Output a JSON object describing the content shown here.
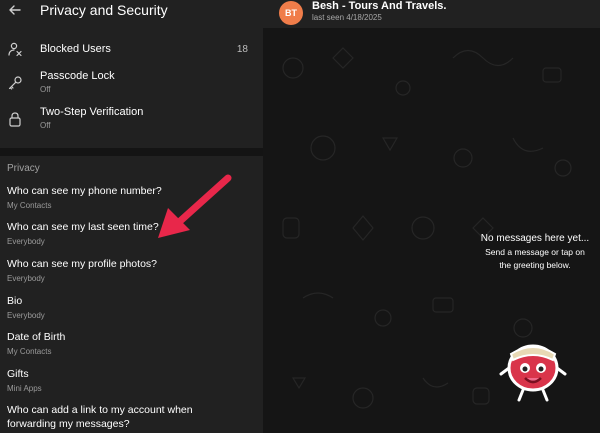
{
  "left_panel": {
    "header": {
      "title": "Privacy and Security"
    },
    "security_items": [
      {
        "title": "Blocked Users",
        "count": "18",
        "icon": "person-blocked-icon"
      },
      {
        "title": "Passcode Lock",
        "subtitle": "Off",
        "icon": "key-icon"
      },
      {
        "title": "Two-Step Verification",
        "subtitle": "Off",
        "icon": "lock-icon"
      }
    ],
    "privacy": {
      "section_title": "Privacy",
      "items": [
        {
          "title": "Who can see my phone number?",
          "value": "My Contacts"
        },
        {
          "title": "Who can see my last seen time?",
          "value": "Everybody"
        },
        {
          "title": "Who can see my profile photos?",
          "value": "Everybody"
        },
        {
          "title": "Bio",
          "value": "Everybody"
        },
        {
          "title": "Date of Birth",
          "value": "My Contacts"
        },
        {
          "title": "Gifts",
          "value": "Mini Apps"
        },
        {
          "title_line1": "Who can add a link to my account when",
          "title_line2": "forwarding my messages?"
        }
      ]
    }
  },
  "chat": {
    "avatar_initials": "BT",
    "avatar_color": "#f07d4a",
    "name": "Besh - Tours And Travels.",
    "status": "last seen 4/18/2025",
    "empty_title": "No messages here yet...",
    "empty_text_line1": "Send a message or tap on",
    "empty_text_line2": "the greeting below."
  },
  "colors": {
    "accent_arrow": "#e8274a",
    "panel_bg": "#212121",
    "chat_bg": "#151515"
  }
}
